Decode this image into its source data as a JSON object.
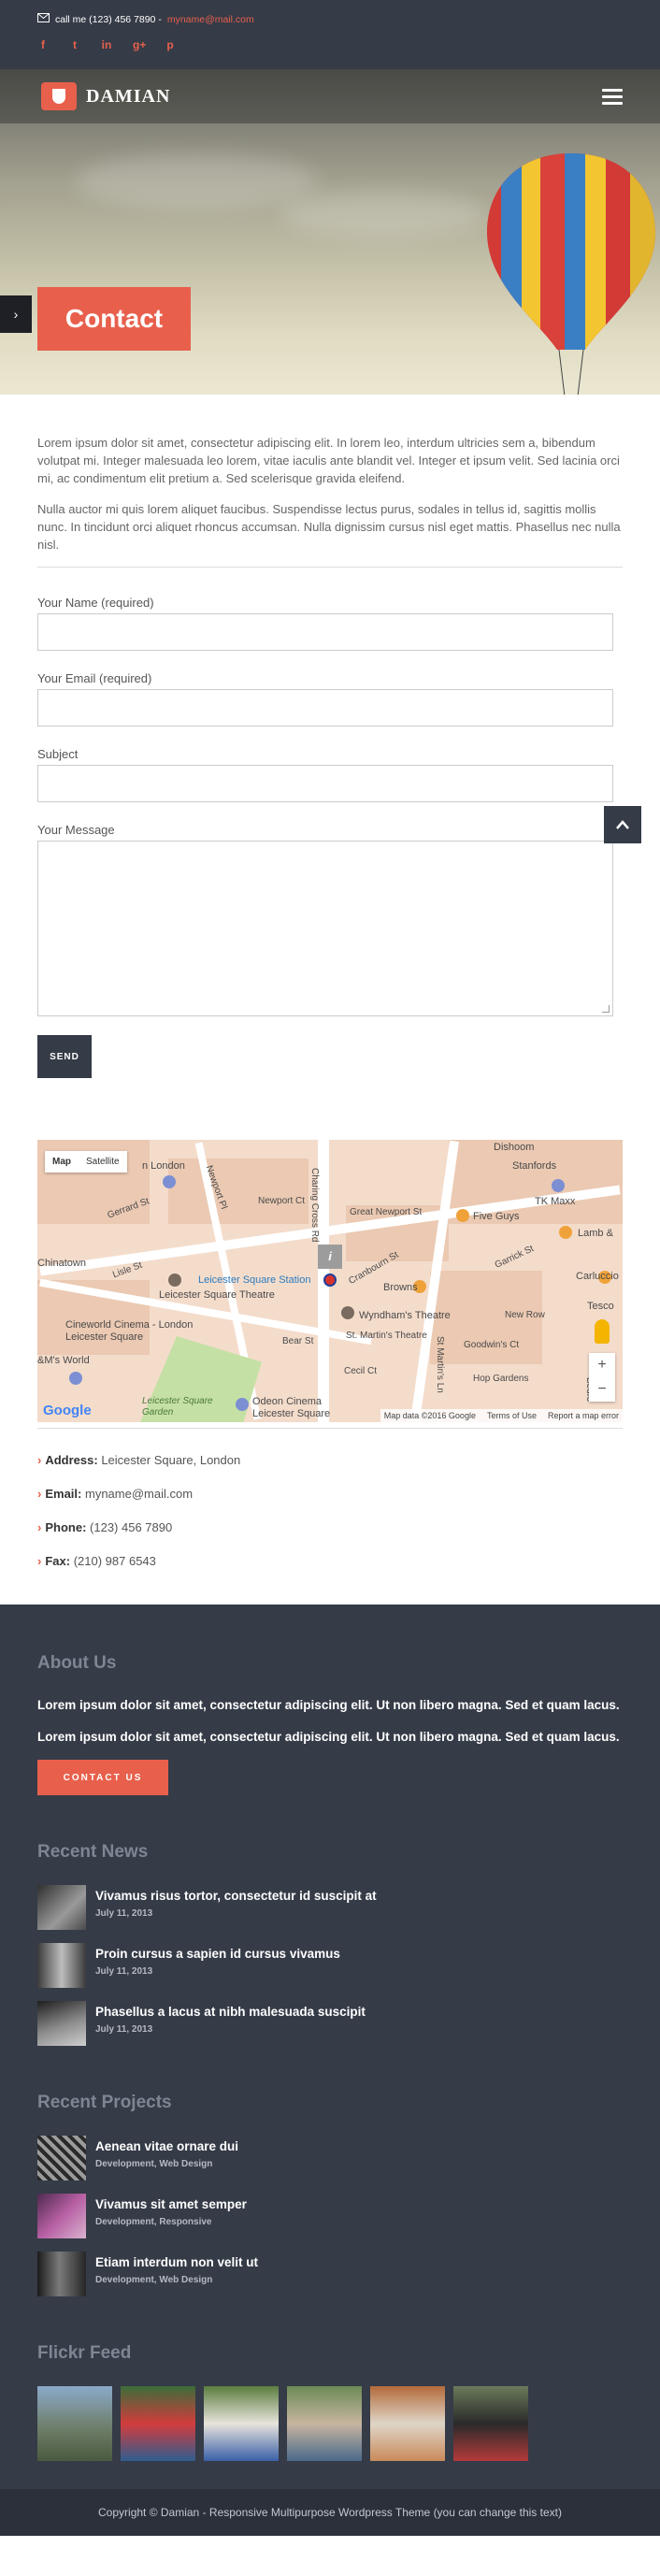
{
  "topbar": {
    "call_label": "call me (123) 456 7890 -",
    "email": "myname@mail.com",
    "socials": [
      {
        "icon": "facebook-icon",
        "glyph": "f"
      },
      {
        "icon": "twitter-icon",
        "glyph": "t"
      },
      {
        "icon": "linkedin-icon",
        "glyph": "in"
      },
      {
        "icon": "google-plus-icon",
        "glyph": "g+"
      },
      {
        "icon": "pinterest-icon",
        "glyph": "p"
      }
    ]
  },
  "brand": {
    "name": "DAMIAN"
  },
  "hero": {
    "title": "Contact"
  },
  "intro": [
    "Lorem ipsum dolor sit amet, consectetur adipiscing elit. In lorem leo, interdum ultricies sem a, bibendum volutpat mi. Integer malesuada leo lorem, vitae iaculis ante blandit vel. Integer et ipsum velit. Sed lacinia orci mi, ac condimentum elit pretium a. Sed scelerisque gravida eleifend.",
    "Nulla auctor mi quis lorem aliquet faucibus. Suspendisse lectus purus, sodales in tellus id, sagittis mollis nunc. In tincidunt orci aliquet rhoncus accumsan. Nulla dignissim cursus nisl eget mattis. Phasellus nec nulla nisl."
  ],
  "form": {
    "name_label": "Your Name (required)",
    "email_label": "Your Email (required)",
    "subject_label": "Subject",
    "message_label": "Your Message",
    "send_label": "SEND"
  },
  "map": {
    "map_tab": "Map",
    "satellite_tab": "Satellite",
    "labels": [
      "Dishoom",
      "Stanfords",
      "TK Maxx",
      "Five Guys",
      "Lamb &",
      "Carluccio",
      "Tesco",
      "Chinatown",
      "Leicester Square Station",
      "Leicester Square Theatre",
      "Browns",
      "Wyndham's Theatre",
      "St. Martin's Theatre",
      "Cineworld Cinema - London Leicester Square",
      "Odeon Cinema Leicester Square",
      "Leicester Square Garden",
      "Newport Ct",
      "Gerrard St",
      "Lisle St",
      "Bear St",
      "Cecil Ct",
      "Great Newport St",
      "Garrick St",
      "New Row",
      "Goodwin's Ct",
      "Hop Gardens",
      "Cranbourn St",
      "Charing Cross Rd",
      "St Martin's Ln",
      "Bedfo",
      "Newport Pl",
      "n London",
      "&M's World"
    ],
    "attribution": [
      "Map data ©2016 Google",
      "Terms of Use",
      "Report a map error"
    ],
    "google_logo": "Google",
    "zoom_in": "+",
    "zoom_out": "−"
  },
  "contact": {
    "address_label": "Address:",
    "address": "Leicester Square, London",
    "email_label": "Email:",
    "email": "myname@mail.com",
    "phone_label": "Phone:",
    "phone": "(123) 456 7890",
    "fax_label": "Fax:",
    "fax": "(210) 987 6543"
  },
  "footer": {
    "about_title": "About Us",
    "about": [
      "Lorem ipsum dolor sit amet, consectetur adipiscing elit. Ut non libero magna. Sed et quam lacus.",
      "Lorem ipsum dolor sit amet, consectetur adipiscing elit. Ut non libero magna. Sed et quam lacus."
    ],
    "cta_label": "CONTACT US",
    "news_title": "Recent News",
    "news": [
      {
        "title": "Vivamus risus tortor, consectetur id suscipit at",
        "date": "July 11, 2013"
      },
      {
        "title": "Proin cursus a sapien id cursus vivamus",
        "date": "July 11, 2013"
      },
      {
        "title": "Phasellus a lacus at nibh malesuada suscipit",
        "date": "July 11, 2013"
      }
    ],
    "projects_title": "Recent Projects",
    "projects": [
      {
        "title": "Aenean vitae ornare dui",
        "cats": "Development, Web Design"
      },
      {
        "title": "Vivamus sit amet semper",
        "cats": "Development, Responsive"
      },
      {
        "title": "Etiam interdum non velit ut",
        "cats": "Development, Web Design"
      }
    ],
    "flickr_title": "Flickr Feed",
    "copyright": "Copyright © Damian - Responsive Multipurpose Wordpress Theme (you can change this text)"
  },
  "colors": {
    "accent": "#e8604c",
    "dark": "#353b47",
    "darker": "#2b303a"
  }
}
